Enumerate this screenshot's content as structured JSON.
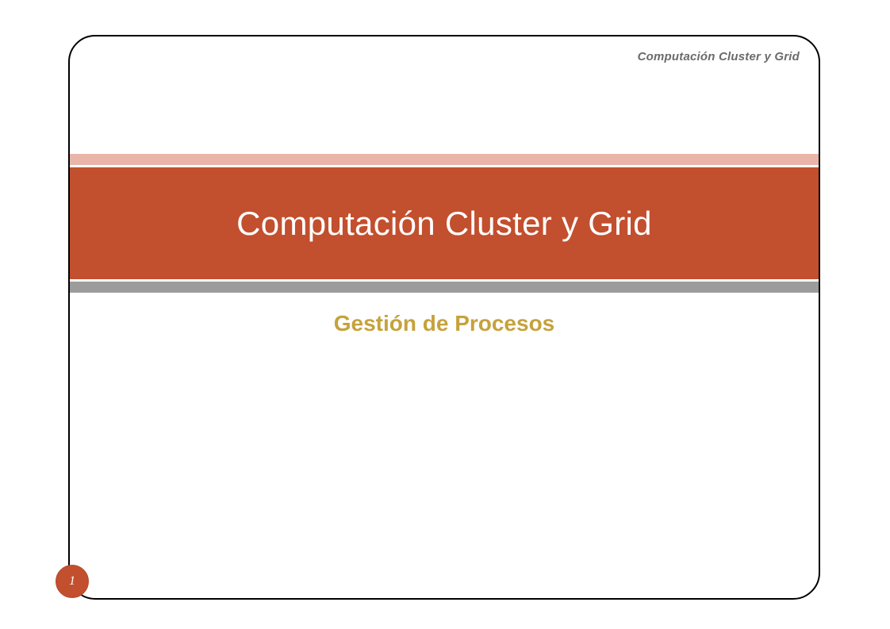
{
  "header": {
    "label": "Computación Cluster y Grid"
  },
  "title": {
    "main": "Computación Cluster y Grid",
    "subtitle": "Gestión de Procesos"
  },
  "page": {
    "number": "1"
  },
  "colors": {
    "accent": "#c24f2e",
    "pink": "#e9b4a9",
    "gray_band": "#9c9c9c",
    "subtitle": "#c6a23c"
  }
}
